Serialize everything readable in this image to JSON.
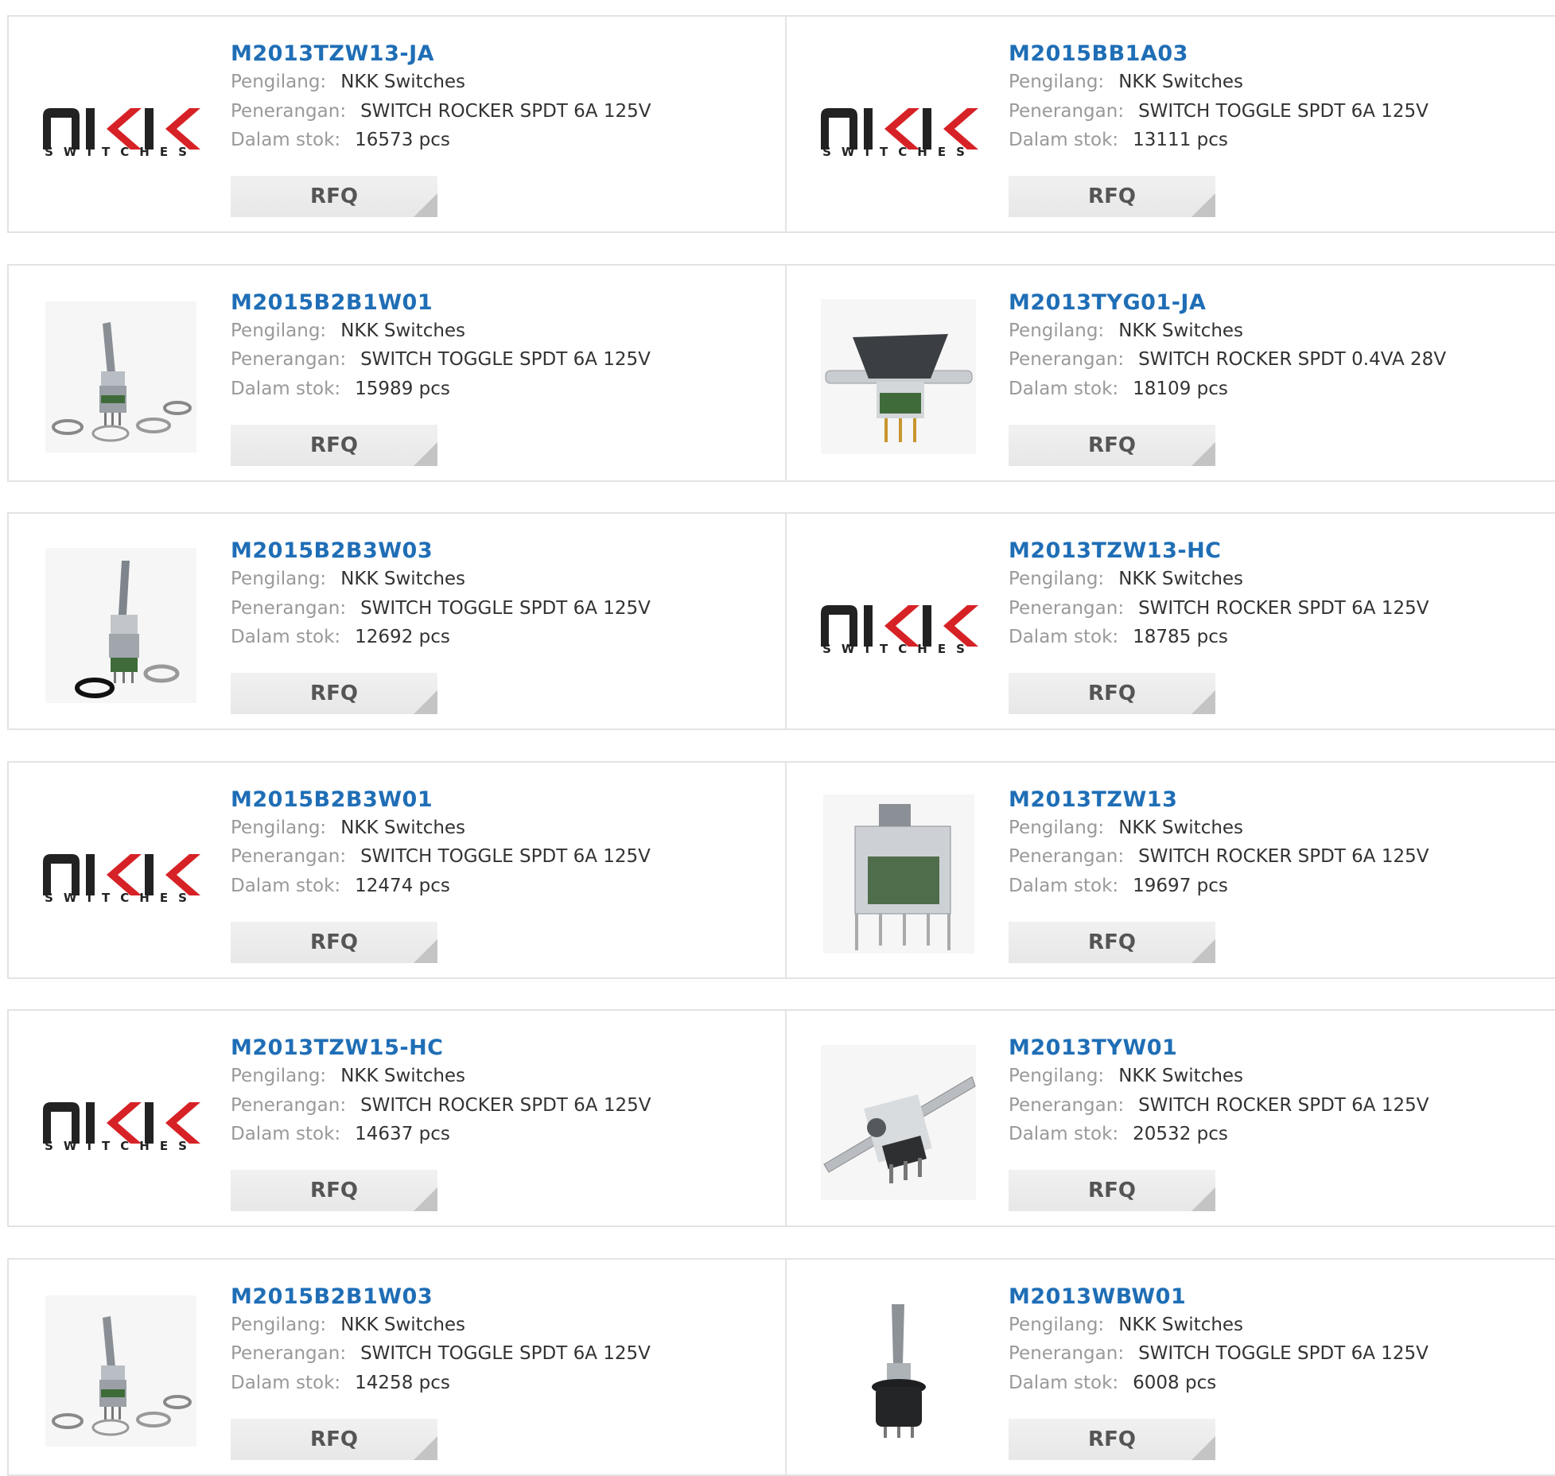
{
  "labels": {
    "manufacturer": "Pengilang:",
    "description": "Penerangan:",
    "stock": "Dalam stok:",
    "rfq": "RFQ"
  },
  "logo_text": "SWITCHES",
  "products": [
    {
      "part": "M2013TZW13-JA",
      "manufacturer": "NKK Switches",
      "description": "SWITCH ROCKER SPDT 6A 125V",
      "stock": "16573 pcs",
      "image": "nkk-logo"
    },
    {
      "part": "M2015BB1A03",
      "manufacturer": "NKK Switches",
      "description": "SWITCH TOGGLE SPDT 6A 125V",
      "stock": "13111 pcs",
      "image": "nkk-logo"
    },
    {
      "part": "M2015B2B1W01",
      "manufacturer": "NKK Switches",
      "description": "SWITCH TOGGLE SPDT 6A 125V",
      "stock": "15989 pcs",
      "image": "toggle-switch-kit"
    },
    {
      "part": "M2013TYG01-JA",
      "manufacturer": "NKK Switches",
      "description": "SWITCH ROCKER SPDT 0.4VA 28V",
      "stock": "18109 pcs",
      "image": "rocker-switch-bracket"
    },
    {
      "part": "M2015B2B3W03",
      "manufacturer": "NKK Switches",
      "description": "SWITCH TOGGLE SPDT 6A 125V",
      "stock": "12692 pcs",
      "image": "toggle-switch-ring"
    },
    {
      "part": "M2013TZW13-HC",
      "manufacturer": "NKK Switches",
      "description": "SWITCH ROCKER SPDT 6A 125V",
      "stock": "18785 pcs",
      "image": "nkk-logo"
    },
    {
      "part": "M2015B2B3W01",
      "manufacturer": "NKK Switches",
      "description": "SWITCH TOGGLE SPDT 6A 125V",
      "stock": "12474 pcs",
      "image": "nkk-logo"
    },
    {
      "part": "M2013TZW13",
      "manufacturer": "NKK Switches",
      "description": "SWITCH ROCKER SPDT 6A 125V",
      "stock": "19697 pcs",
      "image": "rocker-switch-pcb"
    },
    {
      "part": "M2013TZW15-HC",
      "manufacturer": "NKK Switches",
      "description": "SWITCH ROCKER SPDT 6A 125V",
      "stock": "14637 pcs",
      "image": "nkk-logo"
    },
    {
      "part": "M2013TYW01",
      "manufacturer": "NKK Switches",
      "description": "SWITCH ROCKER SPDT 6A 125V",
      "stock": "20532 pcs",
      "image": "rocker-switch-angled"
    },
    {
      "part": "M2015B2B1W03",
      "manufacturer": "NKK Switches",
      "description": "SWITCH TOGGLE SPDT 6A 125V",
      "stock": "14258 pcs",
      "image": "toggle-switch-kit"
    },
    {
      "part": "M2013WBW01",
      "manufacturer": "NKK Switches",
      "description": "SWITCH TOGGLE SPDT 6A 125V",
      "stock": "6008 pcs",
      "image": "toggle-switch-black"
    }
  ]
}
